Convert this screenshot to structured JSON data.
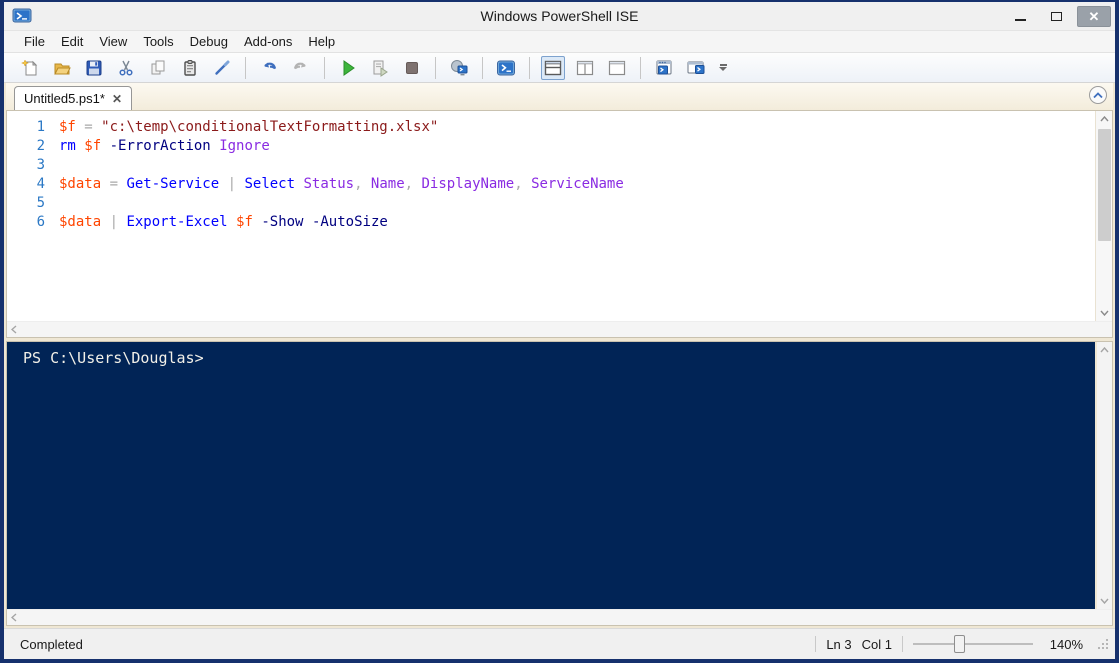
{
  "window": {
    "title": "Windows PowerShell ISE",
    "controls": [
      "minimize-icon",
      "maximize-icon",
      "close-icon"
    ],
    "border_color": "#16316d"
  },
  "menu": {
    "items": [
      "File",
      "Edit",
      "View",
      "Tools",
      "Debug",
      "Add-ons",
      "Help"
    ]
  },
  "toolbar": {
    "icons": [
      "new-script-icon",
      "open-icon",
      "save-icon",
      "cut-icon",
      "copy-icon",
      "paste-icon",
      "clear-console-icon",
      "undo-icon",
      "redo-icon",
      "run-script-icon",
      "run-selection-icon",
      "stop-operation-icon",
      "new-remote-powershell-tab-icon",
      "start-powershell-icon",
      "show-script-pane-top-icon",
      "show-script-pane-right-icon",
      "show-script-pane-maximized-icon",
      "show-command-window-icon",
      "open-powershell-window-icon",
      "toolbar-overflow-icon"
    ],
    "selected_layout": "show-script-pane-top"
  },
  "tabs": [
    {
      "label": "Untitled5.ps1*",
      "close_glyph": "✕"
    }
  ],
  "editor": {
    "lines": [
      {
        "n": "1",
        "tokens": [
          [
            "var",
            "$f"
          ],
          [
            "op",
            " = "
          ],
          [
            "str",
            "\"c:\\temp\\conditionalTextFormatting.xlsx\""
          ]
        ]
      },
      {
        "n": "2",
        "tokens": [
          [
            "cmd",
            "rm"
          ],
          [
            "plain",
            " "
          ],
          [
            "var",
            "$f"
          ],
          [
            "plain",
            " "
          ],
          [
            "param",
            "-ErrorAction"
          ],
          [
            "plain",
            " "
          ],
          [
            "arg",
            "Ignore"
          ]
        ]
      },
      {
        "n": "3",
        "tokens": []
      },
      {
        "n": "4",
        "tokens": [
          [
            "var",
            "$data"
          ],
          [
            "op",
            " = "
          ],
          [
            "cmd",
            "Get-Service"
          ],
          [
            "op",
            " | "
          ],
          [
            "cmd",
            "Select"
          ],
          [
            "plain",
            " "
          ],
          [
            "arg",
            "Status"
          ],
          [
            "op",
            ", "
          ],
          [
            "arg",
            "Name"
          ],
          [
            "op",
            ", "
          ],
          [
            "arg",
            "DisplayName"
          ],
          [
            "op",
            ", "
          ],
          [
            "arg",
            "ServiceName"
          ]
        ]
      },
      {
        "n": "5",
        "tokens": []
      },
      {
        "n": "6",
        "tokens": [
          [
            "var",
            "$data"
          ],
          [
            "op",
            " | "
          ],
          [
            "cmd",
            "Export-Excel"
          ],
          [
            "plain",
            " "
          ],
          [
            "var",
            "$f"
          ],
          [
            "plain",
            " "
          ],
          [
            "param",
            "-Show"
          ],
          [
            "plain",
            " "
          ],
          [
            "param",
            "-AutoSize"
          ]
        ]
      }
    ],
    "syntax_colors": {
      "line_number": "#2b78c5",
      "variable": "#ff4500",
      "cmdlet": "#0000ff",
      "parameter": "#000080",
      "argument": "#8a2be2",
      "string": "#8b1a1a",
      "operator": "#a9a9a9"
    }
  },
  "console": {
    "prompt": "PS C:\\Users\\Douglas>",
    "background": "#012456",
    "text_color": "#f2f0e8"
  },
  "status": {
    "state": "Completed",
    "line": "Ln 3",
    "column": "Col 1",
    "zoom": "140%"
  }
}
